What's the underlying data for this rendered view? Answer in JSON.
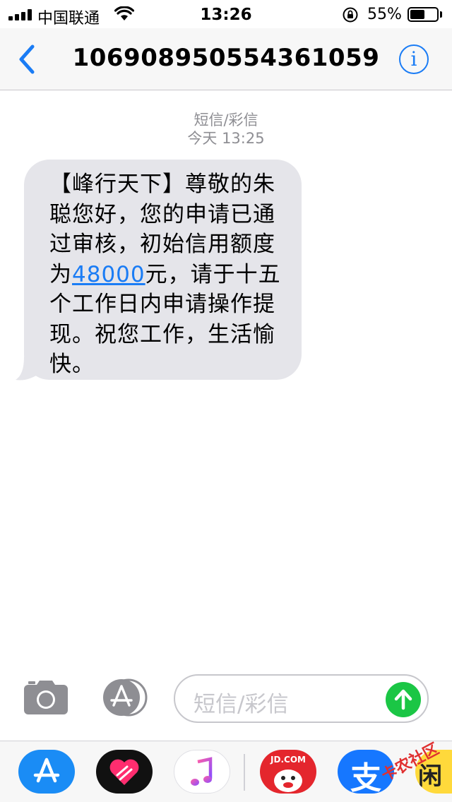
{
  "status_bar": {
    "carrier": "中国联通",
    "time": "13:26",
    "battery_percent": "55%",
    "battery_level": 0.55
  },
  "nav": {
    "title": "106908950554361059"
  },
  "conversation": {
    "message_type": "短信/彩信",
    "timestamp": "今天 13:25",
    "message": {
      "lines": [
        "【峰行天下】尊敬的朱",
        "聪您好，您的申请已通",
        "过审核，初始信用额度"
      ],
      "line4_before": "为",
      "amount": "48000",
      "line4_after": "元，请于十五",
      "lines_end": [
        "个工作日内申请操作提",
        "现。祝您工作，生活愉",
        "快。"
      ]
    }
  },
  "input": {
    "placeholder": "短信/彩信"
  },
  "app_drawer": {
    "jd_label": "JD.COM",
    "alipay_glyph": "支",
    "xianyu_glyph": "闲"
  },
  "watermark": "卡农社区",
  "colors": {
    "accent": "#1a7cf5",
    "bubble": "#e5e5ea",
    "send": "#1bc645"
  }
}
